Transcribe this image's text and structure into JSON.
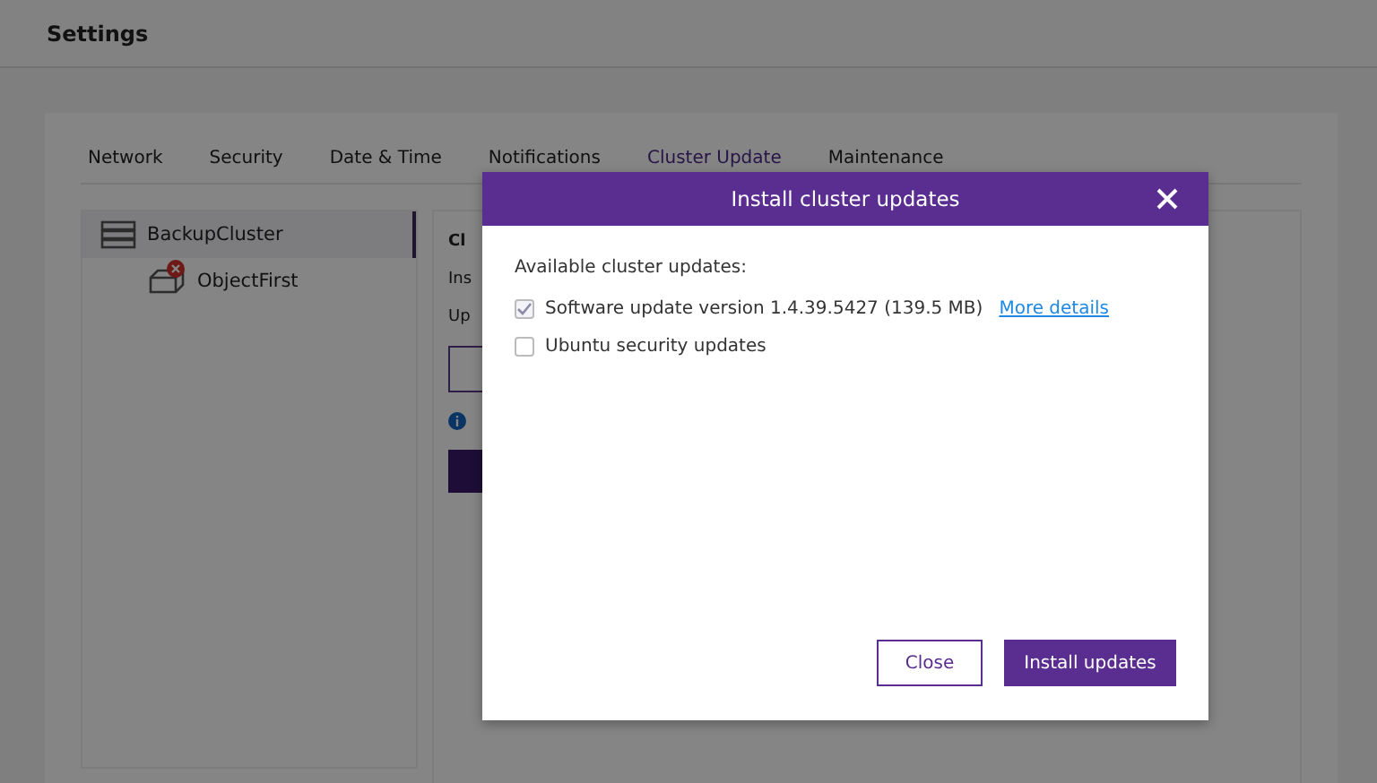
{
  "page": {
    "title": "Settings"
  },
  "tabs": [
    {
      "label": "Network",
      "selected": false
    },
    {
      "label": "Security",
      "selected": false
    },
    {
      "label": "Date & Time",
      "selected": false
    },
    {
      "label": "Notifications",
      "selected": false
    },
    {
      "label": "Cluster Update",
      "selected": true
    },
    {
      "label": "Maintenance",
      "selected": false
    }
  ],
  "tree": [
    {
      "label": "BackupCluster",
      "selected": true,
      "children": [
        {
          "label": "ObjectFirst",
          "selected": false,
          "error": true
        }
      ]
    }
  ],
  "panel": {
    "lines": [
      "Cl",
      "Ins",
      "Up"
    ]
  },
  "dialog": {
    "title": "Install cluster updates",
    "heading": "Available cluster updates:",
    "updates": [
      {
        "label": "Software update version 1.4.39.5427 (139.5 MB)",
        "checked": true,
        "link": "More details"
      },
      {
        "label": "Ubuntu security updates",
        "checked": false
      }
    ],
    "buttons": [
      {
        "label": "Close",
        "kind": "secondary"
      },
      {
        "label": "Install updates",
        "kind": "primary"
      }
    ]
  }
}
